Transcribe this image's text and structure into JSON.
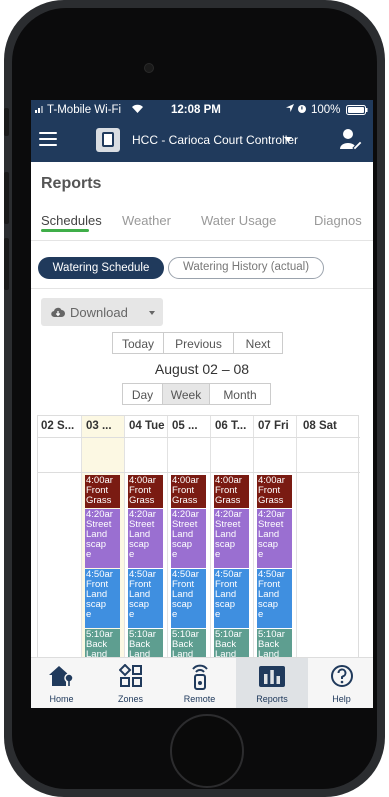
{
  "status_bar": {
    "carrier": "T-Mobile Wi-Fi",
    "time": "12:08 PM",
    "battery": "100%"
  },
  "app_bar": {
    "controller_title": "HCC - Carioca Court Controller",
    "icons": [
      "menu-icon",
      "controller-icon",
      "user-wrench-icon"
    ]
  },
  "page": {
    "title": "Reports"
  },
  "tabs": [
    {
      "label": "Schedules",
      "active": true
    },
    {
      "label": "Weather",
      "active": false
    },
    {
      "label": "Water Usage",
      "active": false
    },
    {
      "label": "Diagnos",
      "active": false
    }
  ],
  "toggle": {
    "schedule_label": "Watering Schedule",
    "history_label": "Watering History (actual)"
  },
  "download": {
    "label": "Download"
  },
  "nav_buttons": {
    "today": "Today",
    "previous": "Previous",
    "next": "Next"
  },
  "date_range": "August 02 – 08",
  "views": [
    {
      "label": "Day",
      "selected": false
    },
    {
      "label": "Week",
      "selected": true
    },
    {
      "label": "Month",
      "selected": false
    }
  ],
  "calendar": {
    "columns": [
      "02 S...",
      "03 ...",
      "04 Tue",
      "05 ...",
      "06 T...",
      "07 Fri",
      "08 Sat"
    ],
    "events": [
      {
        "time": "4:00ar",
        "lines": [
          "Front",
          "Grass"
        ],
        "color": "#7a1b12"
      },
      {
        "time": "4:20ar",
        "lines": [
          "Street",
          "Land",
          "scap",
          "e"
        ],
        "color": "#9a6fd1"
      },
      {
        "time": "4:50ar",
        "lines": [
          "Front",
          "Land",
          "scap",
          "e"
        ],
        "color": "#3f8fe0"
      },
      {
        "time": "5:10ar",
        "lines": [
          "Back",
          "Land"
        ],
        "color": "#5e9e90"
      }
    ],
    "event_columns": [
      "03 ...",
      "04 Tue",
      "05 ...",
      "06 T...",
      "07 Fri"
    ]
  },
  "bottom_nav": [
    {
      "label": "Home",
      "icon": "home-icon",
      "active": false
    },
    {
      "label": "Zones",
      "icon": "zones-icon",
      "active": false
    },
    {
      "label": "Remote",
      "icon": "remote-icon",
      "active": false
    },
    {
      "label": "Reports",
      "icon": "reports-icon",
      "active": true
    },
    {
      "label": "Help",
      "icon": "help-icon",
      "active": false
    }
  ],
  "colors": {
    "navbar": "#203a5c",
    "accent_green": "#3fae49",
    "today_highlight": "#fcf8e3"
  }
}
